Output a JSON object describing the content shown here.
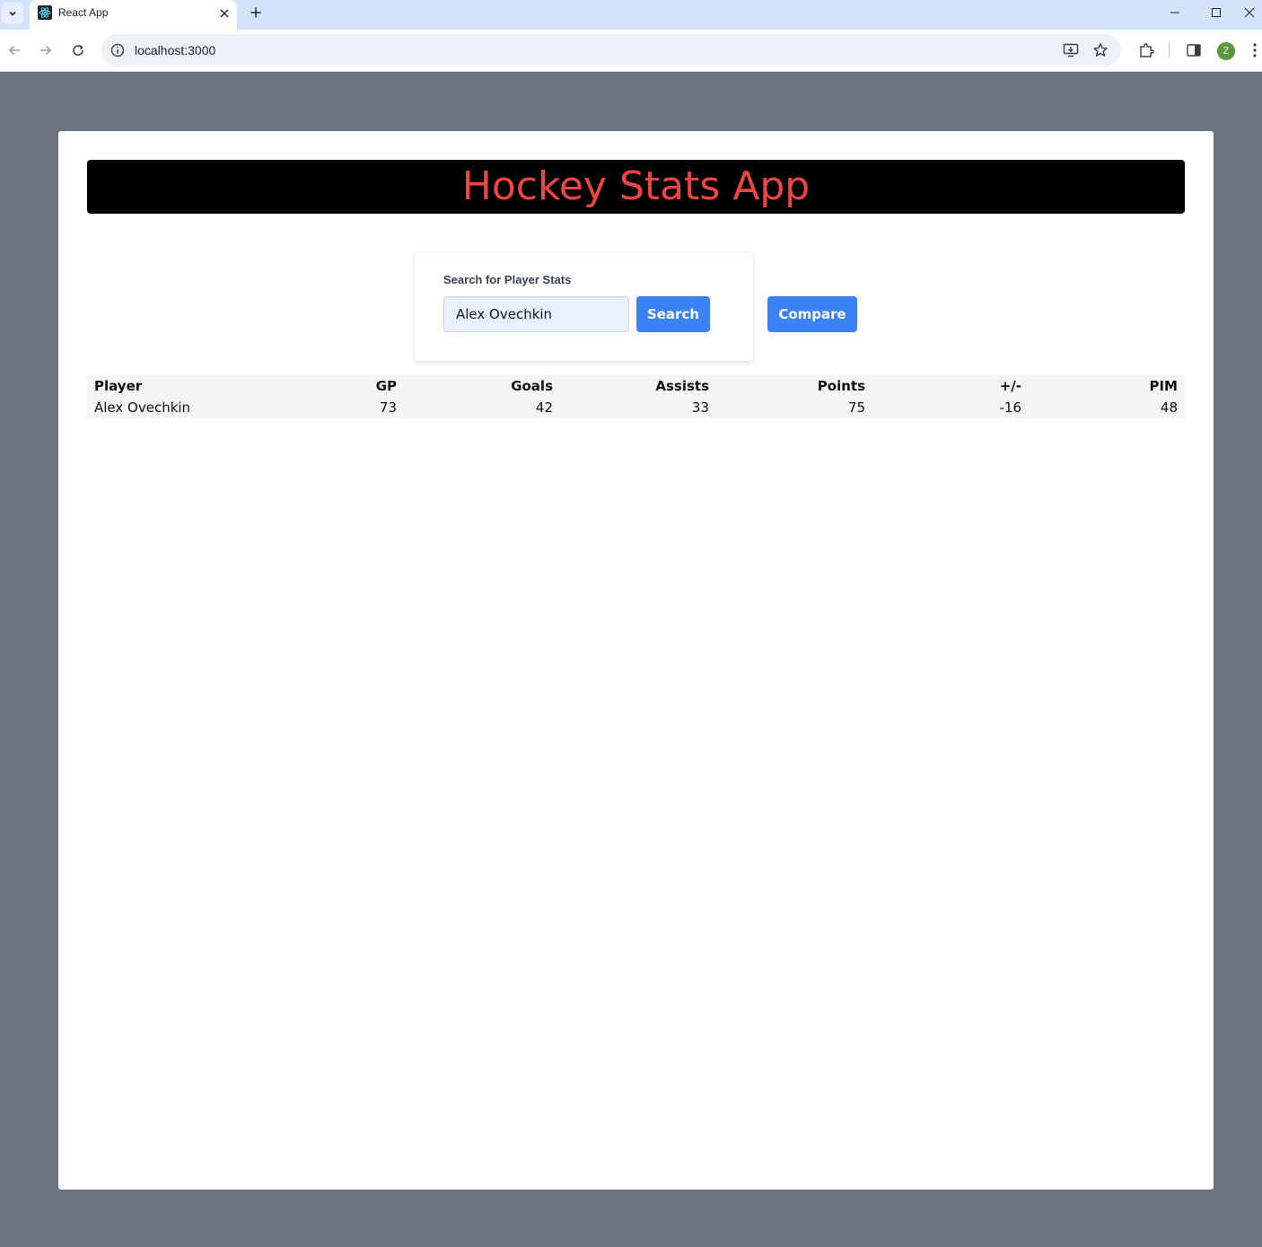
{
  "browser": {
    "tab_title": "React App",
    "url": "localhost:3000",
    "profile_initial": "Z",
    "icons": {
      "tab_list": "chevron-down-icon",
      "favicon": "react-icon",
      "tab_close": "close-icon",
      "new_tab": "plus-icon",
      "minimize": "minimize-icon",
      "maximize": "maximize-icon",
      "close_window": "close-icon",
      "back": "arrow-left-icon",
      "forward": "arrow-right-icon",
      "reload": "reload-icon",
      "site_info": "info-icon",
      "install": "install-icon",
      "bookmark": "star-icon",
      "extensions": "puzzle-icon",
      "side_panel": "side-panel-icon",
      "menu": "kebab-menu-icon"
    }
  },
  "app": {
    "title": "Hockey Stats App",
    "title_color": "#ef4444",
    "accent_color": "#3b82f6",
    "search": {
      "label": "Search for Player Stats",
      "value": "Alex Ovechkin",
      "button_label": "Search"
    },
    "compare_button_label": "Compare",
    "table": {
      "headers": [
        "Player",
        "GP",
        "Goals",
        "Assists",
        "Points",
        "+/-",
        "PIM"
      ],
      "rows": [
        [
          "Alex Ovechkin",
          "73",
          "42",
          "33",
          "75",
          "-16",
          "48"
        ]
      ]
    }
  }
}
